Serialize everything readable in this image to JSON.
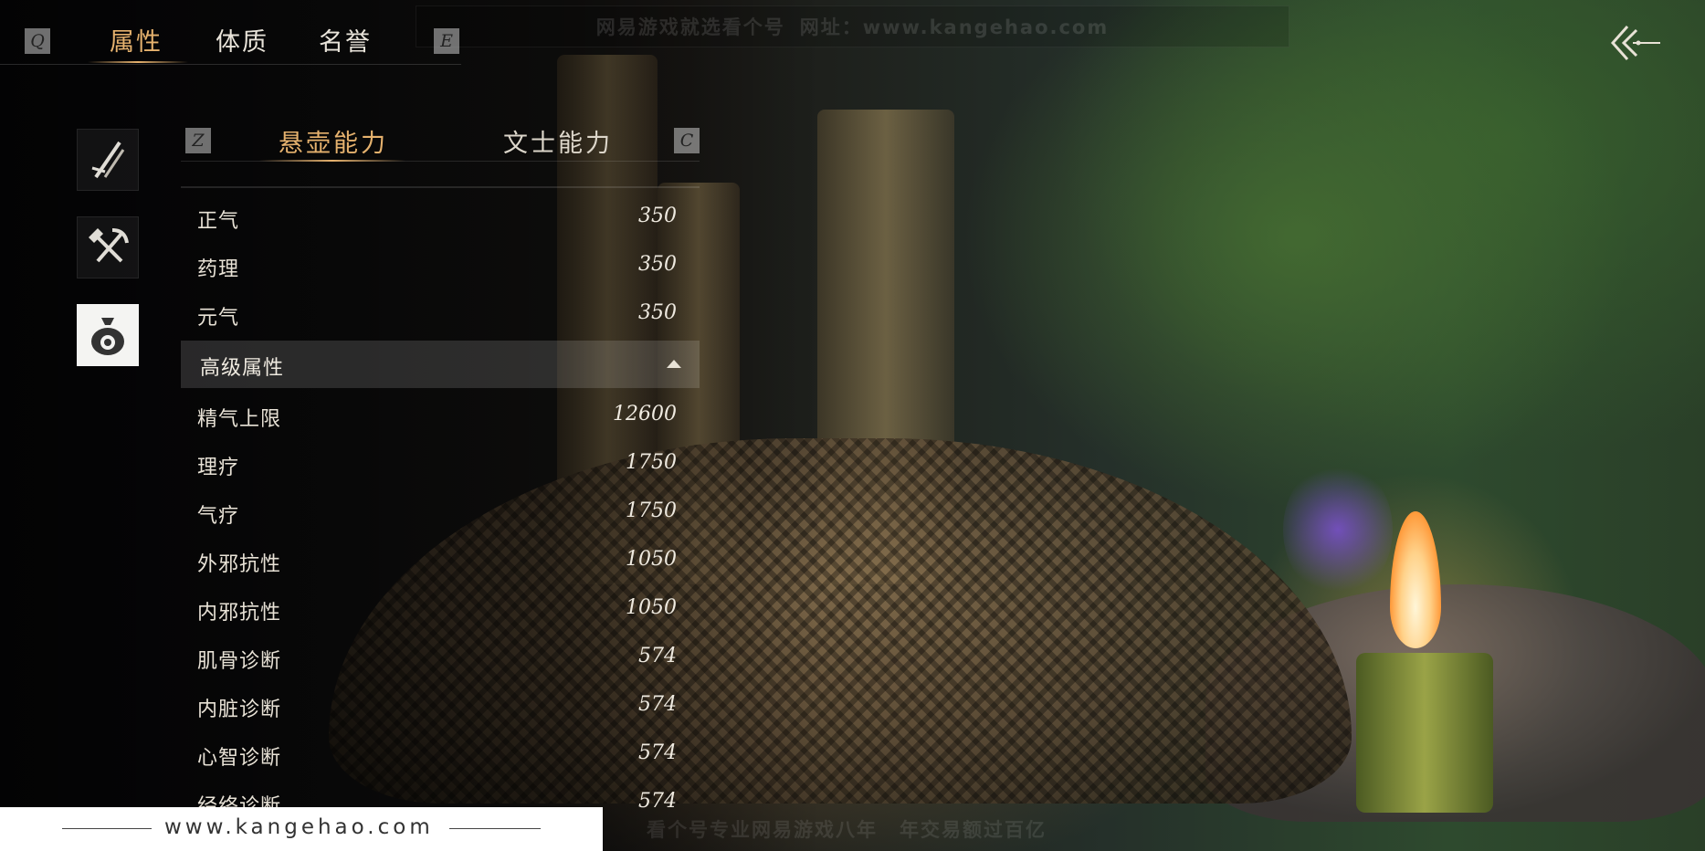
{
  "nav": {
    "left_key": "Q",
    "right_key": "E",
    "tabs": [
      {
        "label": "属性",
        "active": true
      },
      {
        "label": "体质",
        "active": false
      },
      {
        "label": "名誉",
        "active": false
      }
    ]
  },
  "watermark_top": {
    "left": "网易游戏就选看个号",
    "right": "网址：www.kangehao.com"
  },
  "side_icons": [
    {
      "name": "sword-icon",
      "active": false
    },
    {
      "name": "shovel-pickaxe-icon",
      "active": false
    },
    {
      "name": "medicine-pouch-icon",
      "active": true
    }
  ],
  "subtabs": {
    "left_key": "Z",
    "right_key": "C",
    "items": [
      {
        "label": "悬壶能力",
        "active": true
      },
      {
        "label": "文士能力",
        "active": false
      }
    ]
  },
  "stats_basic": [
    {
      "label": "正气",
      "value": "350"
    },
    {
      "label": "药理",
      "value": "350"
    },
    {
      "label": "元气",
      "value": "350"
    }
  ],
  "advanced_section": {
    "label": "高级属性",
    "expanded": true
  },
  "stats_advanced": [
    {
      "label": "精气上限",
      "value": "12600"
    },
    {
      "label": "理疗",
      "value": "1750"
    },
    {
      "label": "气疗",
      "value": "1750"
    },
    {
      "label": "外邪抗性",
      "value": "1050"
    },
    {
      "label": "内邪抗性",
      "value": "1050"
    },
    {
      "label": "肌骨诊断",
      "value": "574"
    },
    {
      "label": "内脏诊断",
      "value": "574"
    },
    {
      "label": "心智诊断",
      "value": "574"
    },
    {
      "label": "经络诊断",
      "value": "574"
    }
  ],
  "watermark_bottom": {
    "site": "www.kangehao.com",
    "slogan_1": "看个号专业网易游戏八年",
    "slogan_2": "年交易额过百亿"
  },
  "colors": {
    "accent": "#e6b26e",
    "text": "#e8e2d6"
  }
}
